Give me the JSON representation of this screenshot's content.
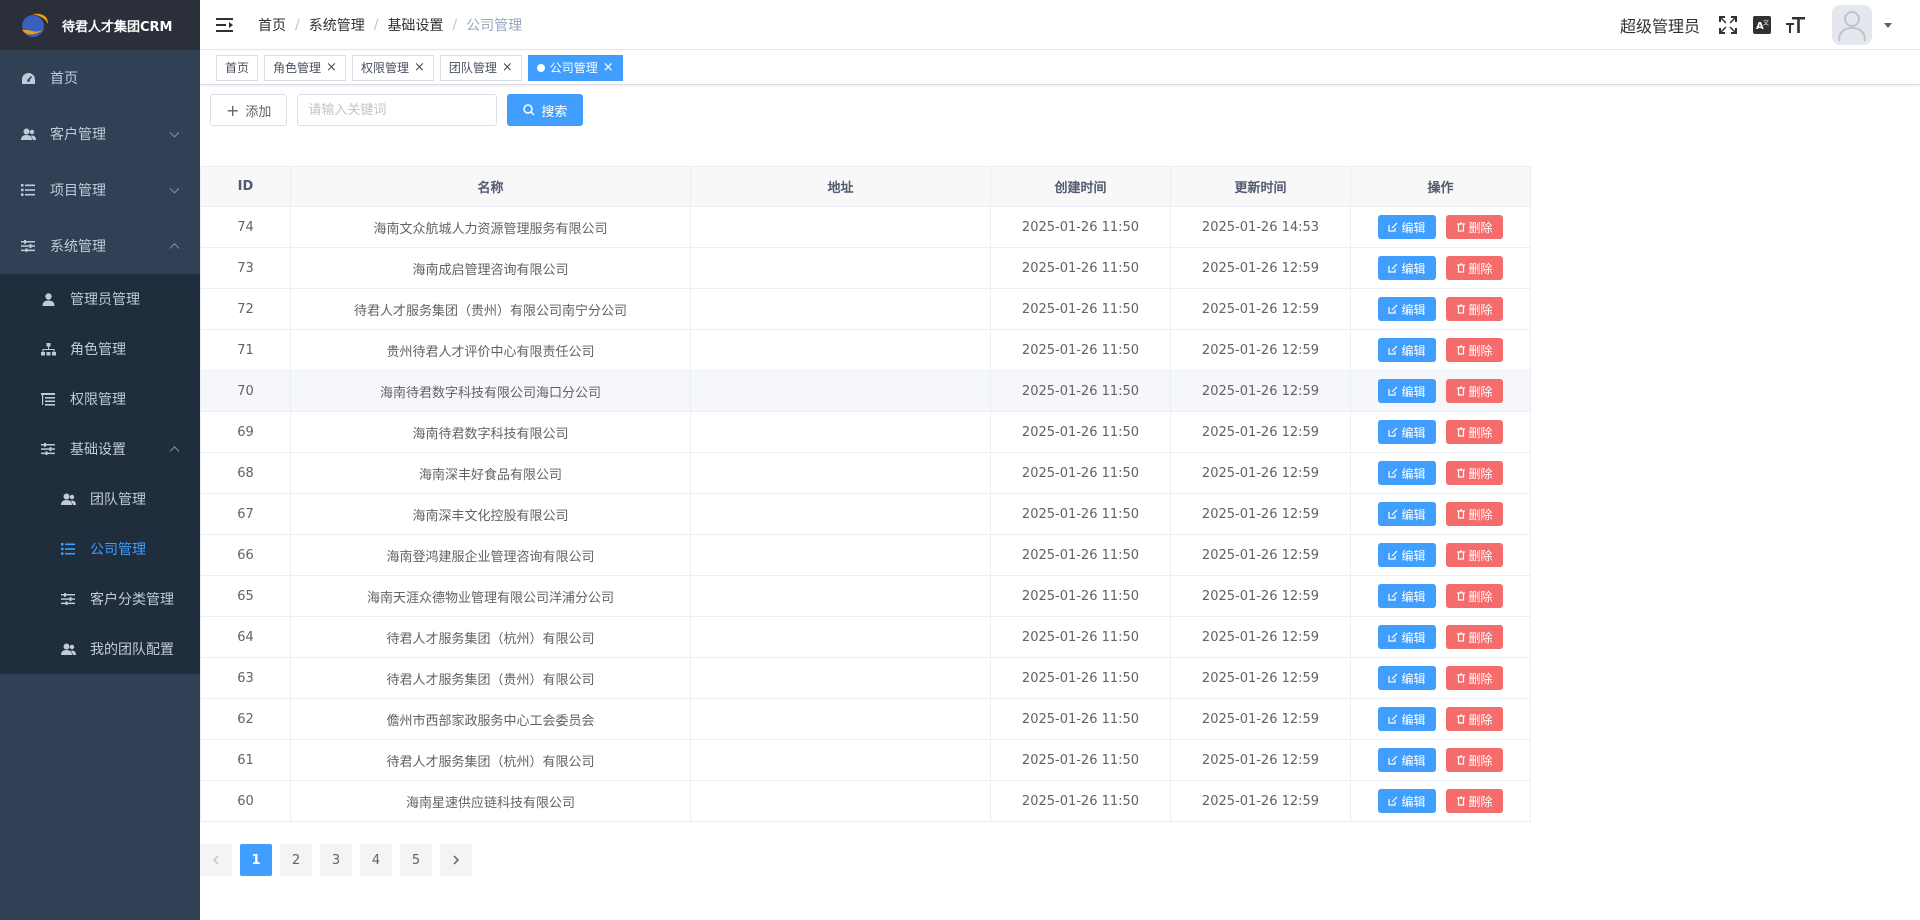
{
  "app": {
    "title": "待君人才集团CRM"
  },
  "sidebar": {
    "items": [
      {
        "label": "首页",
        "icon": "dashboard-icon"
      },
      {
        "label": "客户管理",
        "icon": "user-group-icon"
      },
      {
        "label": "项目管理",
        "icon": "list-icon"
      },
      {
        "label": "系统管理",
        "icon": "settings-sliders-icon"
      }
    ],
    "system_children": [
      {
        "label": "管理员管理",
        "icon": "user-icon"
      },
      {
        "label": "角色管理",
        "icon": "tree-icon"
      },
      {
        "label": "权限管理",
        "icon": "list-tree-icon"
      },
      {
        "label": "基础设置",
        "icon": "settings-sliders-icon"
      }
    ],
    "basic_children": [
      {
        "label": "团队管理",
        "icon": "user-group-icon"
      },
      {
        "label": "公司管理",
        "icon": "list-icon"
      },
      {
        "label": "客户分类管理",
        "icon": "settings-sliders-icon"
      },
      {
        "label": "我的团队配置",
        "icon": "user-group-icon"
      }
    ]
  },
  "navbar": {
    "breadcrumb": [
      "首页",
      "系统管理",
      "基础设置",
      "公司管理"
    ],
    "username": "超级管理员"
  },
  "tags": [
    "首页",
    "角色管理",
    "权限管理",
    "团队管理",
    "公司管理"
  ],
  "toolbar": {
    "add_label": "添加",
    "search_placeholder": "请输入关键词",
    "search_label": "搜索"
  },
  "table": {
    "headers": [
      "ID",
      "名称",
      "地址",
      "创建时间",
      "更新时间",
      "操作"
    ],
    "edit_label": "编辑",
    "delete_label": "删除",
    "rows": [
      {
        "id": "74",
        "name": "海南文众航城人力资源管理服务有限公司",
        "address": "",
        "created": "2025-01-26 11:50",
        "updated": "2025-01-26 14:53"
      },
      {
        "id": "73",
        "name": "海南成启管理咨询有限公司",
        "address": "",
        "created": "2025-01-26 11:50",
        "updated": "2025-01-26 12:59"
      },
      {
        "id": "72",
        "name": "待君人才服务集团（贵州）有限公司南宁分公司",
        "address": "",
        "created": "2025-01-26 11:50",
        "updated": "2025-01-26 12:59"
      },
      {
        "id": "71",
        "name": "贵州待君人才评价中心有限责任公司",
        "address": "",
        "created": "2025-01-26 11:50",
        "updated": "2025-01-26 12:59"
      },
      {
        "id": "70",
        "name": "海南待君数字科技有限公司海口分公司",
        "address": "",
        "created": "2025-01-26 11:50",
        "updated": "2025-01-26 12:59"
      },
      {
        "id": "69",
        "name": "海南待君数字科技有限公司",
        "address": "",
        "created": "2025-01-26 11:50",
        "updated": "2025-01-26 12:59"
      },
      {
        "id": "68",
        "name": "海南深丰好食品有限公司",
        "address": "",
        "created": "2025-01-26 11:50",
        "updated": "2025-01-26 12:59"
      },
      {
        "id": "67",
        "name": "海南深丰文化控股有限公司",
        "address": "",
        "created": "2025-01-26 11:50",
        "updated": "2025-01-26 12:59"
      },
      {
        "id": "66",
        "name": "海南登鸿建服企业管理咨询有限公司",
        "address": "",
        "created": "2025-01-26 11:50",
        "updated": "2025-01-26 12:59"
      },
      {
        "id": "65",
        "name": "海南天涯众德物业管理有限公司洋浦分公司",
        "address": "",
        "created": "2025-01-26 11:50",
        "updated": "2025-01-26 12:59"
      },
      {
        "id": "64",
        "name": "待君人才服务集团（杭州）有限公司",
        "address": "",
        "created": "2025-01-26 11:50",
        "updated": "2025-01-26 12:59"
      },
      {
        "id": "63",
        "name": "待君人才服务集团（贵州）有限公司",
        "address": "",
        "created": "2025-01-26 11:50",
        "updated": "2025-01-26 12:59"
      },
      {
        "id": "62",
        "name": "儋州市西部家政服务中心工会委员会",
        "address": "",
        "created": "2025-01-26 11:50",
        "updated": "2025-01-26 12:59"
      },
      {
        "id": "61",
        "name": "待君人才服务集团（杭州）有限公司",
        "address": "",
        "created": "2025-01-26 11:50",
        "updated": "2025-01-26 12:59"
      },
      {
        "id": "60",
        "name": "海南星速供应链科技有限公司",
        "address": "",
        "created": "2025-01-26 11:50",
        "updated": "2025-01-26 12:59"
      }
    ]
  },
  "pagination": {
    "pages": [
      "1",
      "2",
      "3",
      "4",
      "5"
    ],
    "current": "1"
  },
  "colors": {
    "sidebar_bg": "#304156",
    "primary": "#409eff",
    "danger": "#f56c6c"
  }
}
